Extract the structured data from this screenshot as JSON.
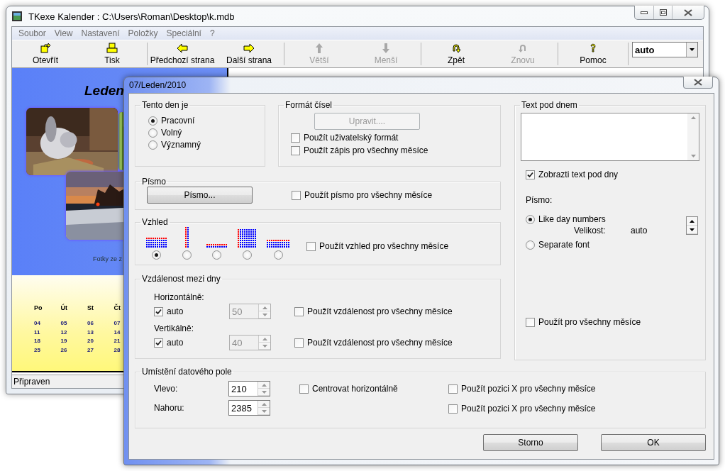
{
  "main_window": {
    "title": "TKexe Kalender : C:\\Users\\Roman\\Desktop\\k.mdb",
    "menu": [
      "Soubor",
      "View",
      "Nastavení",
      "Položky",
      "Speciální",
      "?"
    ],
    "toolbar_groups": [
      {
        "buttons": [
          {
            "label": "Otevřít",
            "kind": "open",
            "disabled": false
          },
          {
            "label": "Tisk",
            "kind": "print",
            "disabled": false
          }
        ]
      },
      {
        "buttons": [
          {
            "label": "Předchozí strana",
            "kind": "previous",
            "disabled": false
          },
          {
            "label": "Další strana",
            "kind": "next",
            "disabled": false
          }
        ]
      },
      {
        "buttons": [
          {
            "label": "Větší",
            "kind": "larger",
            "disabled": true
          },
          {
            "label": "Menší",
            "kind": "smaller",
            "disabled": true
          }
        ]
      },
      {
        "buttons": [
          {
            "label": "Zpět",
            "kind": "undo",
            "disabled": false
          },
          {
            "label": "Znovu",
            "kind": "redo",
            "disabled": true
          }
        ]
      },
      {
        "buttons": [
          {
            "label": "Pomoc",
            "kind": "help",
            "disabled": false
          }
        ]
      }
    ],
    "zoom_combo": {
      "value": "auto"
    },
    "calendar_preview": {
      "month": "Leden",
      "caption": "Fotky ze z",
      "weekdays": [
        "Po",
        "Út",
        "St",
        "Čt"
      ],
      "weeks": [
        [
          "04",
          "05",
          "06",
          "07"
        ],
        [
          "11",
          "12",
          "13",
          "14"
        ],
        [
          "18",
          "19",
          "20",
          "21"
        ],
        [
          "25",
          "26",
          "27",
          "28"
        ]
      ]
    },
    "status_bar": "Připraven"
  },
  "dialog": {
    "title": "07/Leden/2010",
    "day_type": {
      "label": "Tento den je",
      "options": [
        {
          "label": "Pracovní",
          "selected": true
        },
        {
          "label": "Volný",
          "selected": false
        },
        {
          "label": "Významný",
          "selected": false
        }
      ]
    },
    "number_format": {
      "label": "Formát čísel",
      "edit_button": {
        "label": "Upravit....",
        "disabled": true
      },
      "options": [
        {
          "label": "Použít uživatelský formát",
          "checked": false
        },
        {
          "label": "Použít zápis pro všechny měsíce",
          "checked": false
        }
      ]
    },
    "font": {
      "label": "Písmo",
      "button": "Písmo...",
      "apply_all": {
        "label": "Použít písmo pro všechny měsíce",
        "checked": false
      }
    },
    "appearance": {
      "label": "Vzhled",
      "layouts": [
        {
          "kind": "block",
          "selected": true
        },
        {
          "kind": "column",
          "selected": false
        },
        {
          "kind": "strip",
          "selected": false
        },
        {
          "kind": "square",
          "selected": false
        },
        {
          "kind": "wide",
          "selected": false
        }
      ],
      "apply_all": {
        "label": "Použít vzhled pro všechny měsíce",
        "checked": false
      }
    },
    "spacing": {
      "label": "Vzdálenost mezi dny",
      "rows": [
        {
          "label": "Horizontálně:",
          "auto": {
            "label": "auto",
            "checked": true
          },
          "value": "50",
          "disabled": true,
          "apply_all": {
            "label": "Použít vzdálenost pro všechny měsíce",
            "checked": false
          }
        },
        {
          "label": "Vertikálně:",
          "auto": {
            "label": "auto",
            "checked": true
          },
          "value": "40",
          "disabled": true,
          "apply_all": {
            "label": "Použít vzdálenost pro všechny měsíce",
            "checked": false
          }
        }
      ]
    },
    "text_below": {
      "label": "Text pod dnem",
      "show": {
        "label": "Zobrazti text pod dny",
        "checked": true
      },
      "font_label": "Písmo:",
      "options": [
        {
          "label": "Like day numbers",
          "selected": true
        },
        {
          "label": "Separate font",
          "selected": false
        }
      ],
      "size_label": "Velikost:",
      "size_value": "auto",
      "apply_all": {
        "label": "Použít pro všechny měsíce",
        "checked": false
      }
    },
    "position": {
      "label": "Umístění datového pole",
      "rows": [
        {
          "label": "Vlevo:",
          "value": "210"
        },
        {
          "label": "Nahoru:",
          "value": "2385"
        }
      ],
      "center": {
        "label": "Centrovat horizontálně",
        "checked": false
      },
      "apply_all": [
        {
          "label": "Použít pozici X pro všechny měsíce",
          "checked": false
        },
        {
          "label": "Použít pozici X pro všechny měsíce",
          "checked": false
        }
      ]
    },
    "buttons": [
      "Storno",
      "OK"
    ]
  }
}
